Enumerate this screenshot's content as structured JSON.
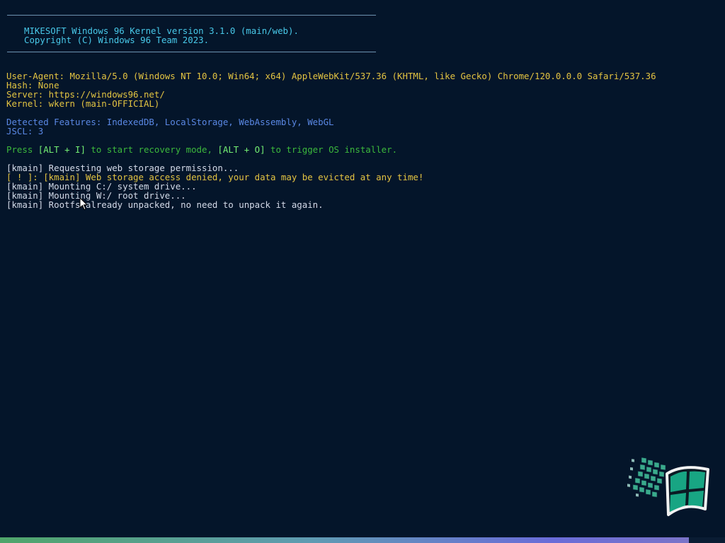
{
  "banner": {
    "line1": "MIKESOFT Windows 96 Kernel version 3.1.0 (main/web).",
    "line2": "Copyright (C) Windows 96 Team 2023."
  },
  "info": {
    "user_agent": "User-Agent: Mozilla/5.0 (Windows NT 10.0; Win64; x64) AppleWebKit/537.36 (KHTML, like Gecko) Chrome/120.0.0.0 Safari/537.36",
    "hash": "Hash: None",
    "server": "Server: https://windows96.net/",
    "kernel": "Kernel: wkern (main-OFFICIAL)"
  },
  "features": {
    "detected": "Detected Features: IndexedDB, LocalStorage, WebAssembly, WebGL",
    "jscl": "JSCL: 3"
  },
  "prompt": {
    "press": "Press ",
    "key1": "[ALT + I]",
    "mid": " to start recovery mode, ",
    "key2": "[ALT + O]",
    "end": " to trigger OS installer."
  },
  "log": [
    "[kmain] Requesting web storage permission...",
    "[ ! ]: [kmain] Web storage access denied, your data may be evicted at any time!",
    "[kmain] Mounting C:/ system drive...",
    "[kmain] Mounting W:/ root drive...",
    "[kmain] Rootfs already unpacked, no need to unpack it again."
  ],
  "colors": {
    "background": "#04152a",
    "banner": "#48c8e8",
    "info": "#e4c442",
    "features": "#5a88e4",
    "prompt": "#3cb83c",
    "prompt_keys": "#74f074",
    "log": "#d4dae8",
    "log_warning": "#e4c442"
  },
  "icons": {
    "logo": "windows96-logo-icon",
    "cursor": "mouse-pointer-icon"
  },
  "progress": {
    "fraction": 0.95
  }
}
